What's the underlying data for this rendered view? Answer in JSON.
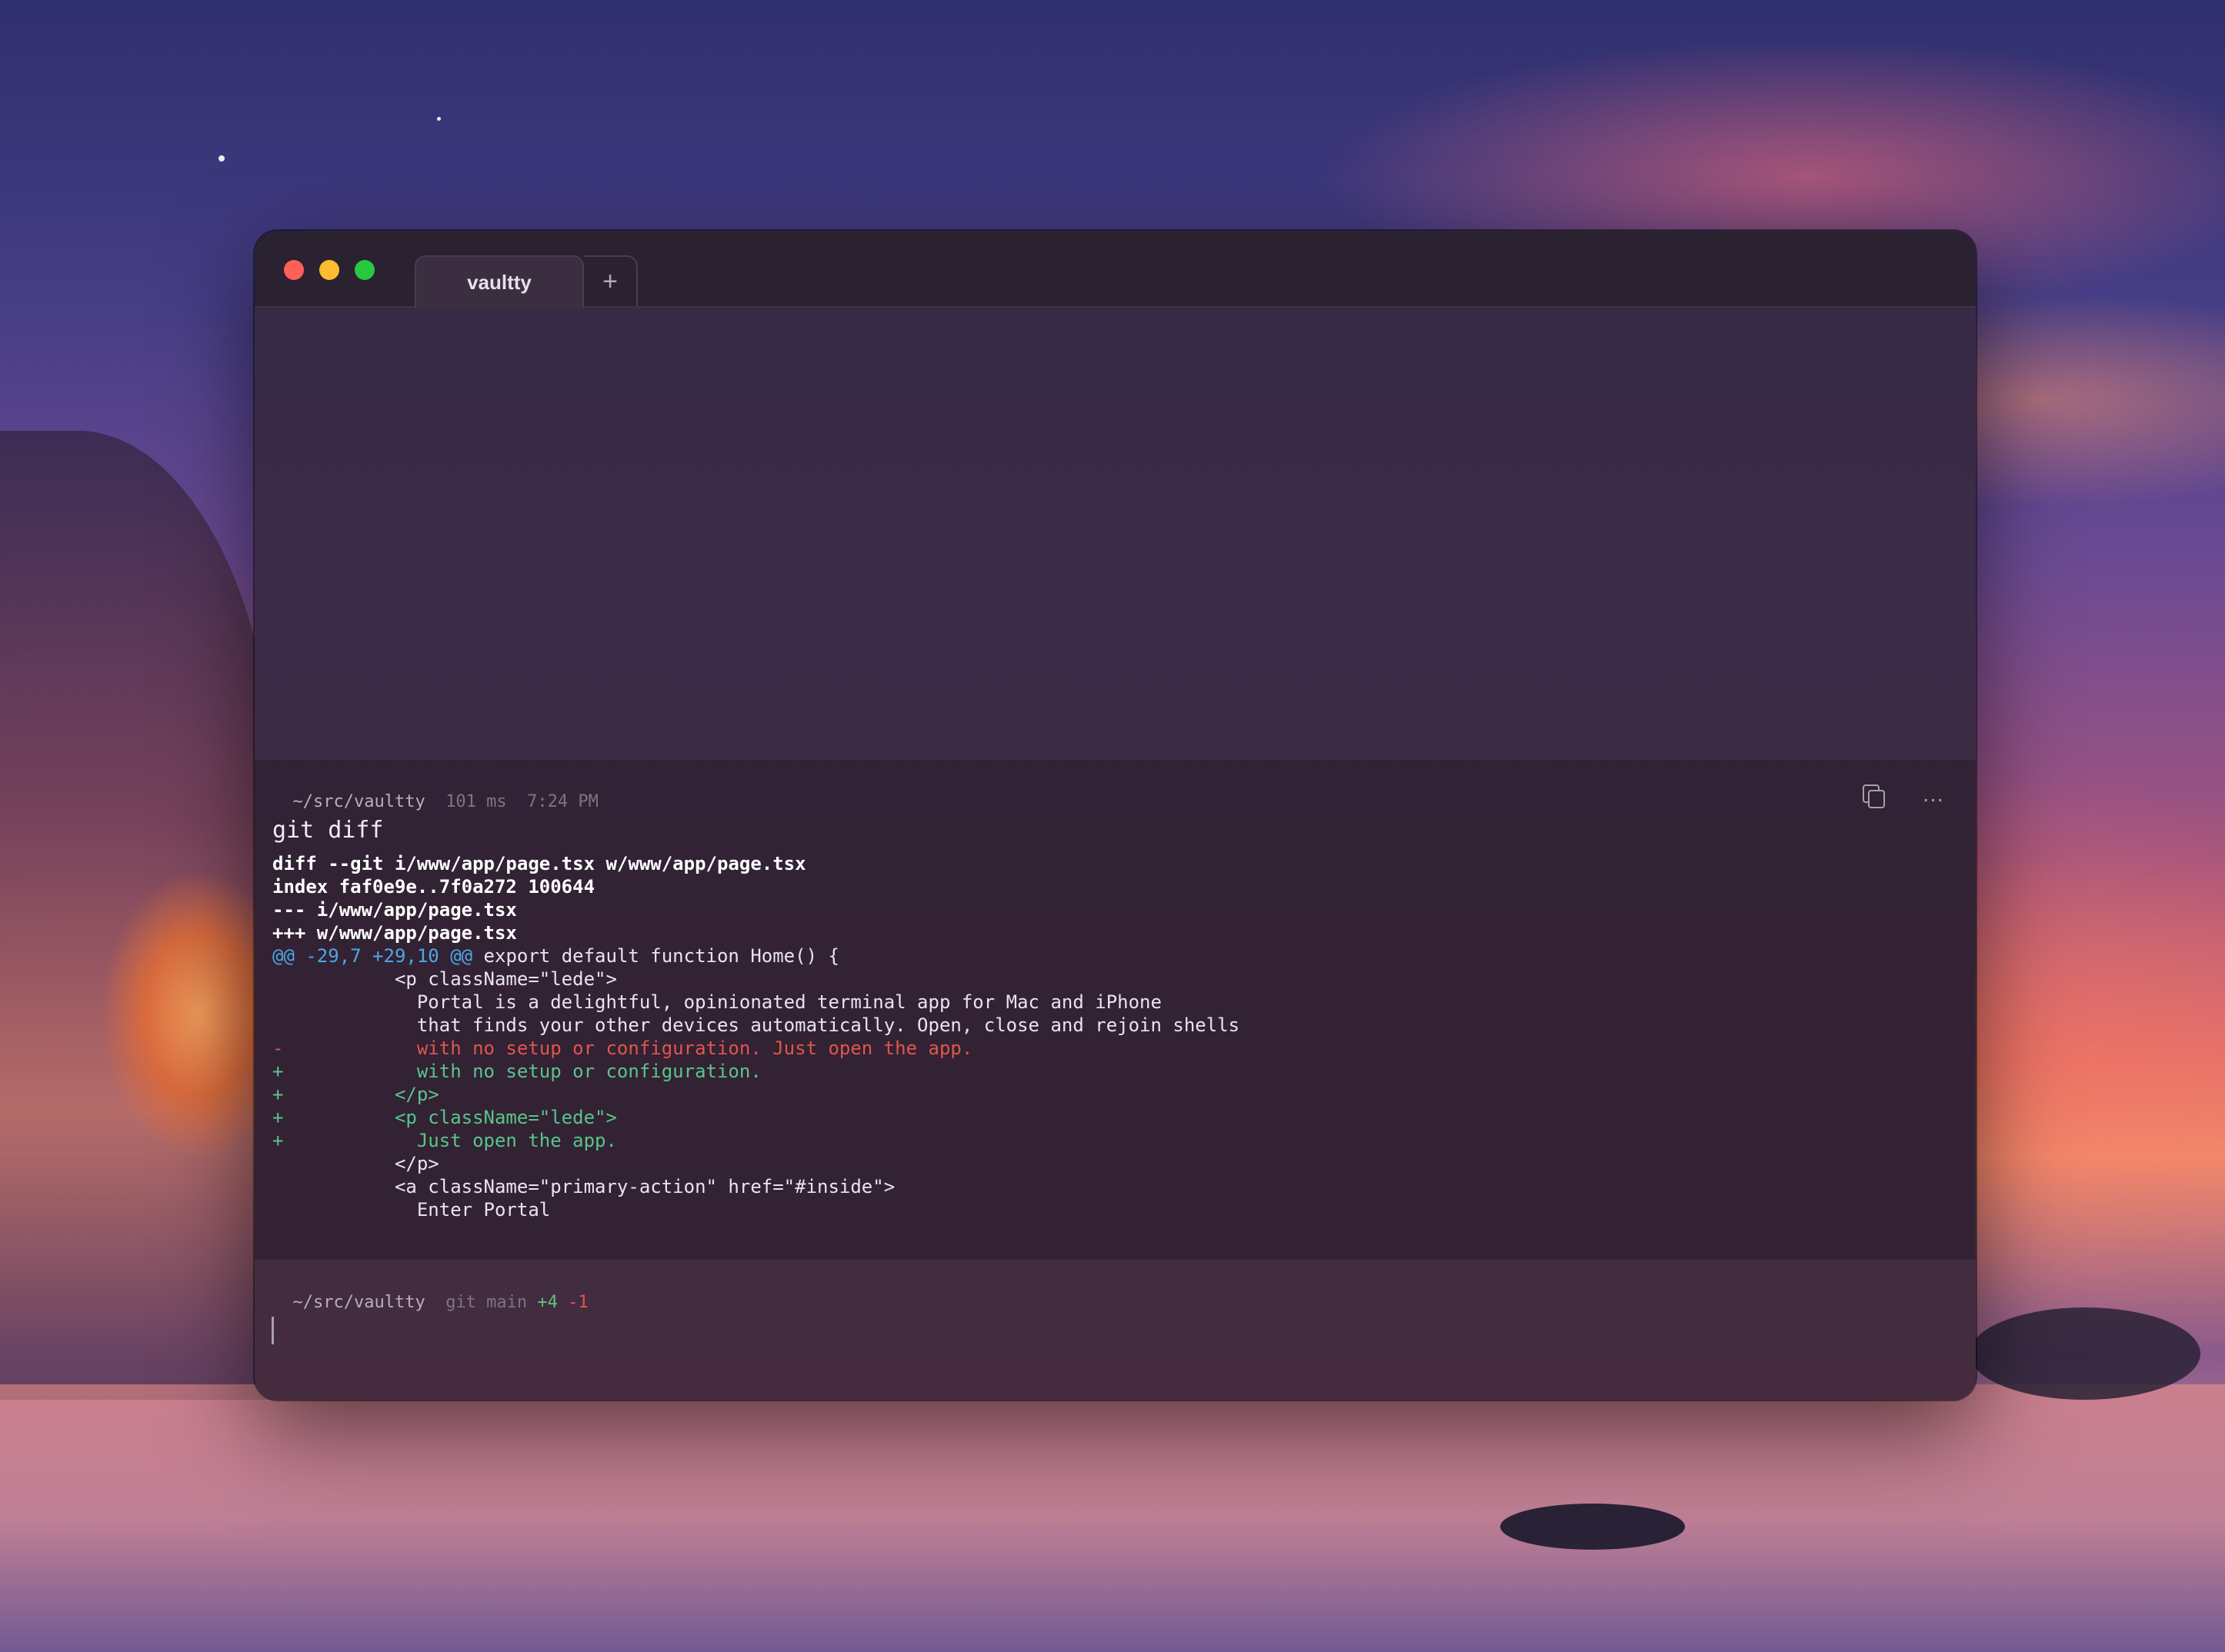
{
  "window": {
    "tab_title": "vaultty",
    "new_tab_label": "+"
  },
  "block": {
    "cwd": "~/src/vaultty",
    "duration": "101 ms",
    "time": "7:24 PM",
    "command": "git diff",
    "copy_icon": "copy-icon",
    "more_label": "...",
    "output": [
      {
        "type": "header",
        "text": "diff --git i/www/app/page.tsx w/www/app/page.tsx"
      },
      {
        "type": "header",
        "text": "index faf0e9e..7f0a272 100644"
      },
      {
        "type": "header",
        "text": "--- i/www/app/page.tsx"
      },
      {
        "type": "header",
        "text": "+++ w/www/app/page.tsx"
      },
      {
        "type": "hunk",
        "range": "@@ -29,7 +29,10 @@",
        "context": " export default function Home() {"
      },
      {
        "type": "context",
        "text": "           <p className=\"lede\">"
      },
      {
        "type": "context",
        "text": "             Portal is a delightful, opinionated terminal app for Mac and iPhone"
      },
      {
        "type": "context",
        "text": "             that finds your other devices automatically. Open, close and rejoin shells"
      },
      {
        "type": "removed",
        "text": "-            with no setup or configuration. Just open the app."
      },
      {
        "type": "added",
        "text": "+            with no setup or configuration."
      },
      {
        "type": "added",
        "text": "+          </p>"
      },
      {
        "type": "added",
        "text": "+          <p className=\"lede\">"
      },
      {
        "type": "added",
        "text": "+            Just open the app."
      },
      {
        "type": "context",
        "text": "           </p>"
      },
      {
        "type": "context",
        "text": "           <a className=\"primary-action\" href=\"#inside\">"
      },
      {
        "type": "context",
        "text": "             Enter Portal"
      }
    ]
  },
  "prompt": {
    "cwd": "~/src/vaultty",
    "vcs": "git main",
    "additions": "+4",
    "deletions": "-1"
  },
  "colors": {
    "added": "#58c58a",
    "removed": "#e0564e",
    "hunk": "#4aa8e6",
    "traffic_red": "#fe5f57",
    "traffic_yellow": "#febc2e",
    "traffic_green": "#28c840"
  }
}
